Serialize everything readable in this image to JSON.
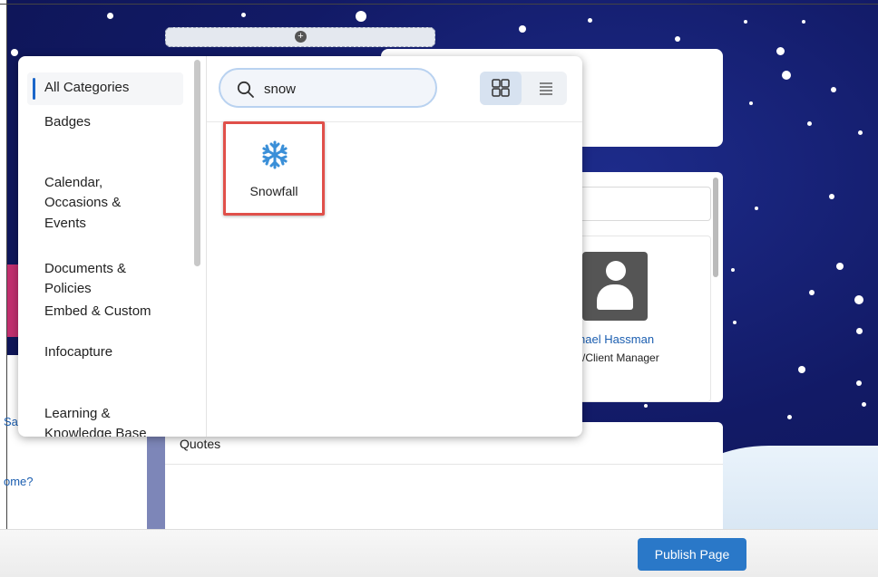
{
  "colors": {
    "accent": "#2a78c8",
    "highlight_border": "#e0504a",
    "snowflake": "#3a8fd8",
    "active_category_bar": "#1b66c9"
  },
  "categories": [
    {
      "label": "All Categories",
      "active": true
    },
    {
      "label": "Badges",
      "active": false
    },
    {
      "label": "Calendar,\nOccasions &\nEvents",
      "active": false
    },
    {
      "label": "Documents &\nPolicies",
      "active": false
    },
    {
      "label": "Embed & Custom",
      "active": false
    },
    {
      "label": "Infocapture",
      "active": false
    },
    {
      "label": "Learning &\nKnowledge Base",
      "active": false
    }
  ],
  "search": {
    "value": "snow",
    "icon": "search-icon"
  },
  "view_toggle": {
    "selected": "grid",
    "options": [
      "grid-view-icon",
      "list-view-icon"
    ]
  },
  "results": [
    {
      "label": "Snowfall",
      "icon": "snowflake-icon",
      "highlighted": true
    }
  ],
  "background_page": {
    "person_name": "hael Hassman",
    "person_role": "r/Client Manager",
    "section_title": "Quotes",
    "left_link_1": "Sa",
    "left_link_2": "ome?"
  },
  "footer": {
    "publish_label": "Publish Page"
  }
}
